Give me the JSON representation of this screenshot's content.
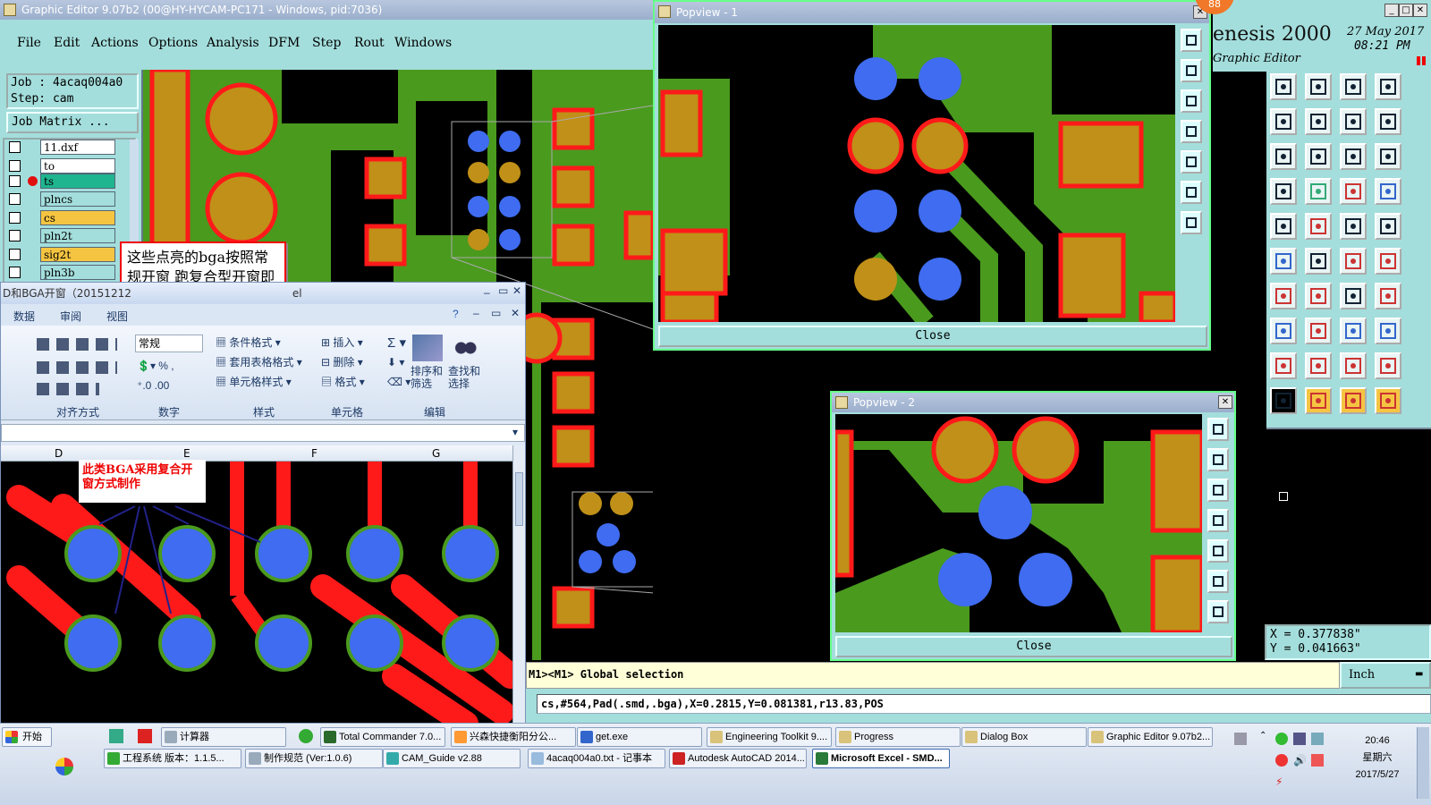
{
  "main": {
    "title": "Graphic Editor 9.07b2 (00@HY-HYCAM-PC171 - Windows, pid:7036)",
    "menu": [
      "File",
      "Edit",
      "Actions",
      "Options",
      "Analysis",
      "DFM",
      "Step",
      "Rout",
      "Windows"
    ],
    "job_label": "Job : 4acaq004a0",
    "step_label": "Step: cam",
    "job_matrix": "Job Matrix ...",
    "layers": [
      {
        "name": "11.dxf",
        "color": "#fff"
      },
      {
        "name": "to",
        "color": "#fff"
      },
      {
        "name": "ts",
        "color": "#1fb58f"
      },
      {
        "name": "plncs",
        "color": "#a3dedc"
      },
      {
        "name": "cs",
        "color": "#f5c542"
      },
      {
        "name": "pln2t",
        "color": "#a3dedc"
      },
      {
        "name": "sig2t",
        "color": "#f5c542"
      },
      {
        "name": "pln3b",
        "color": "#a3dedc"
      }
    ],
    "annotation": "这些点亮的bga按照常规开窗 跑复合型开窗即可",
    "command_line": "M1><M1> Global selection",
    "status_line": "cs,#564,Pad(.smd,.bga),X=0.2815,Y=0.081381,r13.83,POS",
    "units": "Inch",
    "coord_x": "X = 0.377838\"",
    "coord_y": "Y = 0.041663\"",
    "brand": "enesis 2000",
    "brand_sub": "Graphic Editor",
    "date": "27 May 2017",
    "time": "08:21 PM",
    "badge": "88"
  },
  "popview1": {
    "title": "Popview - 1",
    "close": "Close"
  },
  "popview2": {
    "title": "Popview - 2",
    "close": "Close"
  },
  "excel": {
    "title": "D和BGA开窗（20151212",
    "title_tail": "el",
    "tabs": [
      "数据",
      "审阅",
      "视图"
    ],
    "number_format": "常规",
    "cond_format": "条件格式",
    "table_format": "套用表格格式",
    "cell_style": "单元格样式",
    "insert": "插入",
    "delete": "删除",
    "format": "格式",
    "sort_filter": "排序和筛选",
    "find_select": "查找和选择",
    "group_align": "对齐方式",
    "group_number": "数字",
    "group_style": "样式",
    "group_cells": "单元格",
    "group_edit": "编辑",
    "cols": [
      "D",
      "E",
      "F",
      "G"
    ],
    "note": "此类BGA采用复合开窗方式制作"
  },
  "taskbar": {
    "start": "开始",
    "row1": [
      "计算器",
      "Total Commander 7.0...",
      "兴森快捷衡阳分公...",
      "get.exe",
      "Engineering Toolkit 9....",
      "Progress",
      "Dialog Box",
      "Graphic Editor 9.07b2..."
    ],
    "row2": [
      "工程系统  版本：1.1.5...",
      "制作规范 (Ver:1.0.6)",
      "CAM_Guide v2.88",
      "4acaq004a0.txt - 记事本",
      "Autodesk AutoCAD 2014...",
      "Microsoft Excel - SMD..."
    ],
    "clock": "20:46",
    "weekday": "星期六",
    "date": "2017/5/27"
  }
}
